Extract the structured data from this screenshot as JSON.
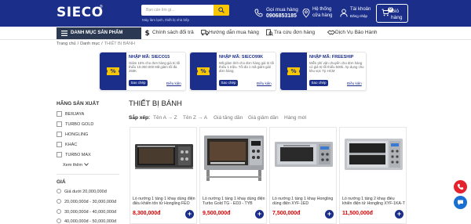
{
  "header": {
    "logo": "SIECO",
    "logo_mark": "®",
    "search_placeholder": "Bạn cần tìm gì...",
    "search_hint": "Máy làm lạnh, thiết bị nhà bếp",
    "phone_label": "Gọi mua hàng",
    "phone_number": "0906853185",
    "store_line1": "Hệ thống",
    "store_line2": "cửa hàng",
    "account_line1": "Tài khoản",
    "account_line2": "Đăng nhập",
    "cart_line1": "Giỏ",
    "cart_line2": "hàng",
    "cart_count": "0"
  },
  "nav": {
    "category_button": "DANH MỤC SẢN PHẨM",
    "items": [
      {
        "label": "Chính sách đổi trả",
        "icon": "dollar-icon"
      },
      {
        "label": "Hướng dẫn mua hàng",
        "icon": "truck-icon"
      },
      {
        "label": "Tra cứu đơn hàng",
        "icon": "search-order-icon"
      },
      {
        "label": "Dịch Vụ Bảo Hành",
        "icon": "handshake-icon"
      }
    ]
  },
  "breadcrumb": [
    "Trang chủ",
    "Danh mục",
    "THIẾT BỊ BÁNH"
  ],
  "coupons": [
    {
      "title": "NHẬP MÃ: SIECO15",
      "desc": "Giảm 15% cho đơn hàng giá trị tối thiểu 10.000.000 Mã giảm tối đa 250K",
      "copy": "Sao chép",
      "terms": "Điều kiện"
    },
    {
      "title": "NHẬP MÃ: SIECO99K",
      "desc": "Mã giảm tính cho đơn hàng giá trị tối thiểu 1 triệu. Tối đa 1 mã giảm giá/đơn hàng.",
      "copy": "Sao chép",
      "terms": "Điều kiện"
    },
    {
      "title": "NHẬP MÃ: FREESHIP",
      "desc": "Miễn phí vận chuyển cho đơn hàng có giá trị tối thiểu 500k. Áp dụng cho khu vực Tp HCM",
      "copy": "Sao chép",
      "terms": "Điều kiện"
    }
  ],
  "sidebar": {
    "brand_title": "HÃNG SẢN XUẤT",
    "brands": [
      "BERJAYA",
      "TURBO GOLD",
      "HONGLING",
      "KHÁC",
      "TURBO MAX"
    ],
    "see_more": "Xem thêm",
    "price_title": "GIÁ",
    "prices": [
      "Giá dưới 20,000,000đ",
      "20,000,000đ - 30,000,000đ",
      "30,000,000đ - 40,000,000đ",
      "40,000,000đ - 50,000,000đ"
    ]
  },
  "main": {
    "title": "THIẾT BỊ BÁNH",
    "sort_label": "Sắp xếp:",
    "sort_options": [
      "Tên A → Z",
      "Tên Z → A",
      "Giá tăng dần",
      "Giá giảm dần",
      "Hàng mới"
    ],
    "products": [
      {
        "name": "Lò nướng 1 tầng 1 khay dùng điện điều khiển tốn tử Hongling FEO 1D",
        "price": "8,300,000đ"
      },
      {
        "name": "Lò nướng 1 tầng 1 khay dùng điện Turbo Gold TG - ED3 - TYB",
        "price": "9,500,000đ"
      },
      {
        "name": "Lò nướng 1 tầng 1 khay Hongling dùng điện XYF-1ED",
        "price": "7,500,000đ"
      },
      {
        "name": "Lò nướng 1 tầng 2 khay điều khiển điện tử Hongling XYF-1KA-T",
        "price": "11,500,000đ"
      }
    ],
    "add_label": "+"
  },
  "colors": {
    "brand": "#1a2e8a",
    "accent": "#f7c600",
    "price": "#d70000",
    "fab_phone": "#e5232e",
    "fab_msg": "#1a6fd1"
  }
}
